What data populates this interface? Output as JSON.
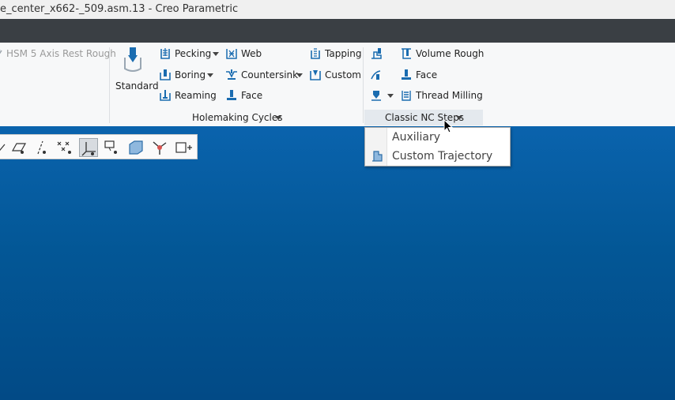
{
  "window": {
    "title": "e_center_x662-_509.asm.13 - Creo Parametric"
  },
  "ribbon": {
    "milling_cut": {
      "label": "HSM 5 Axis Rest Rough",
      "icon": "milling-path-icon"
    },
    "holemaking": {
      "group_label": "Holemaking Cycles",
      "standard": {
        "label": "Standard",
        "icon": "drill-standard-icon"
      },
      "pecking": {
        "label": "Pecking",
        "icon": "pecking-icon"
      },
      "boring": {
        "label": "Boring",
        "icon": "boring-icon"
      },
      "reaming": {
        "label": "Reaming",
        "icon": "reaming-icon"
      },
      "web": {
        "label": "Web",
        "icon": "web-icon"
      },
      "countersink": {
        "label": "Countersink",
        "icon": "countersink-icon"
      },
      "face": {
        "label": "Face",
        "icon": "face-icon"
      },
      "tapping": {
        "label": "Tapping",
        "icon": "tapping-icon"
      },
      "custom": {
        "label": "Custom",
        "icon": "custom-cycle-icon"
      }
    },
    "classic_nc": {
      "group_label": "Classic NC Steps",
      "volume_rough": {
        "label": "Volume Rough",
        "icon": "volume-rough-icon"
      },
      "face": {
        "label": "Face",
        "icon": "face-milling-icon"
      },
      "thread_milling": {
        "label": "Thread Milling",
        "icon": "thread-milling-icon"
      }
    }
  },
  "dropdown_menu": {
    "items": [
      {
        "label": "Auxiliary",
        "icon": ""
      },
      {
        "label": "Custom Trajectory",
        "icon": "custom-trajectory-icon"
      }
    ]
  },
  "view_toolbar": {
    "buttons": [
      "datum-plane-display-icon",
      "datum-axis-display-icon",
      "datum-point-display-icon",
      "coordinate-system-display-icon",
      "annotation-display-icon",
      "surface-display-icon",
      "spin-center-icon",
      "view-manager-icon"
    ],
    "active": "coordinate-system-display-icon"
  },
  "colors": {
    "viewport_top": "#0a63ad",
    "viewport_bottom": "#024a86",
    "tabstrip": "#3a3f44",
    "icon_blue": "#1a6cb0"
  }
}
